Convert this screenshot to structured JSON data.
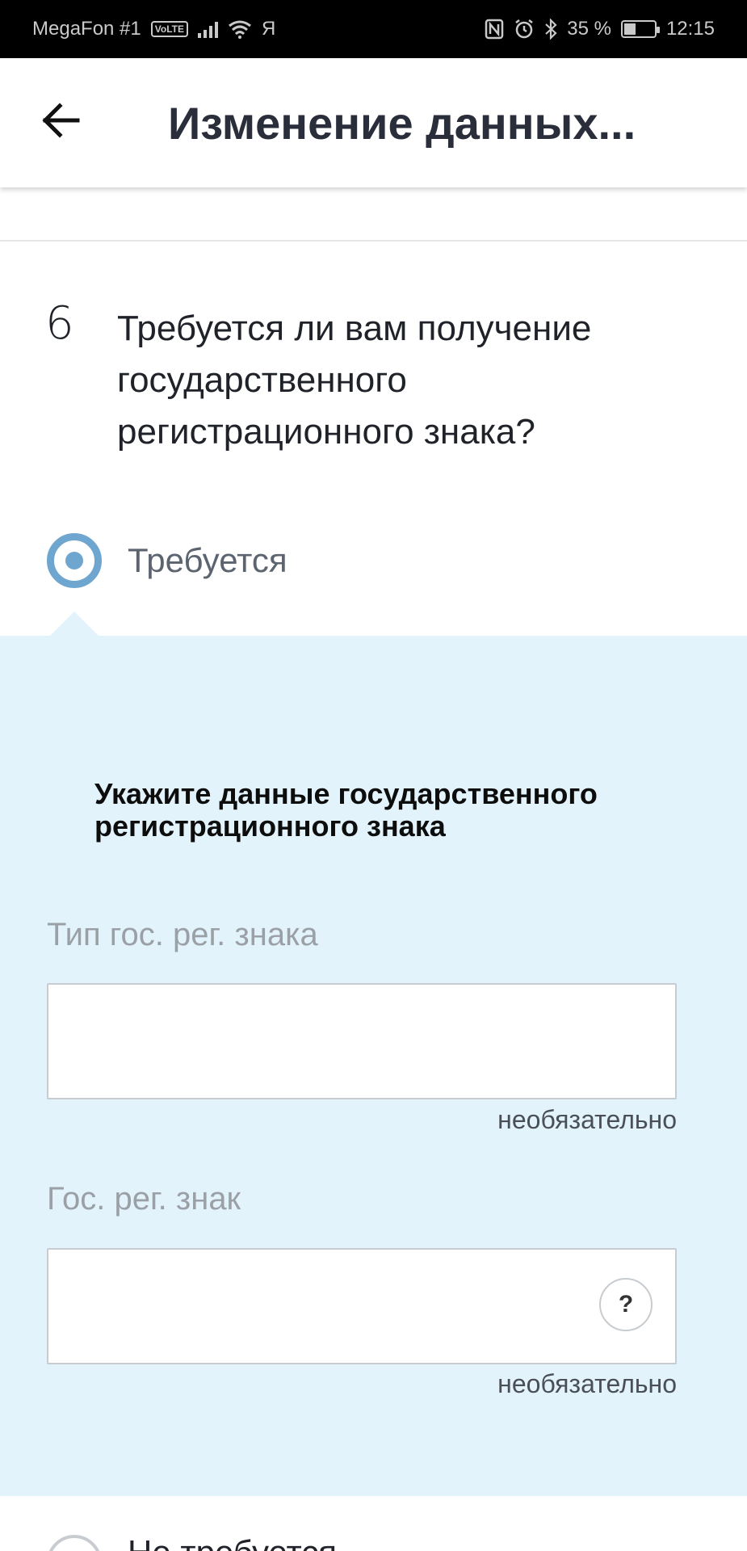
{
  "status_bar": {
    "carrier": "MegaFon #1",
    "volte": "VoLTE",
    "extra": "Я",
    "battery": "35 %",
    "time": "12:15",
    "icons": [
      "signal-icon",
      "wifi-icon",
      "nfc-icon",
      "alarm-icon",
      "bluetooth-icon",
      "battery-icon"
    ]
  },
  "header": {
    "title": "Изменение данных..."
  },
  "question": {
    "number": "6",
    "text": "Требуется ли вам получение государственного регистрационного знака?"
  },
  "options": {
    "selected_label": "Требуется",
    "next_label": "Не требуется"
  },
  "details": {
    "heading": "Укажите данные государственного регистрационного знака",
    "type_field": {
      "label": "Тип гос. рег. знака",
      "value": "",
      "hint": "необязательно"
    },
    "plate_field": {
      "label": "Гос. рег. знак",
      "value": "",
      "hint": "необязательно",
      "help": "?"
    }
  },
  "colors": {
    "accent": "#6fa6cf",
    "panel_bg": "#e3f3fc"
  }
}
